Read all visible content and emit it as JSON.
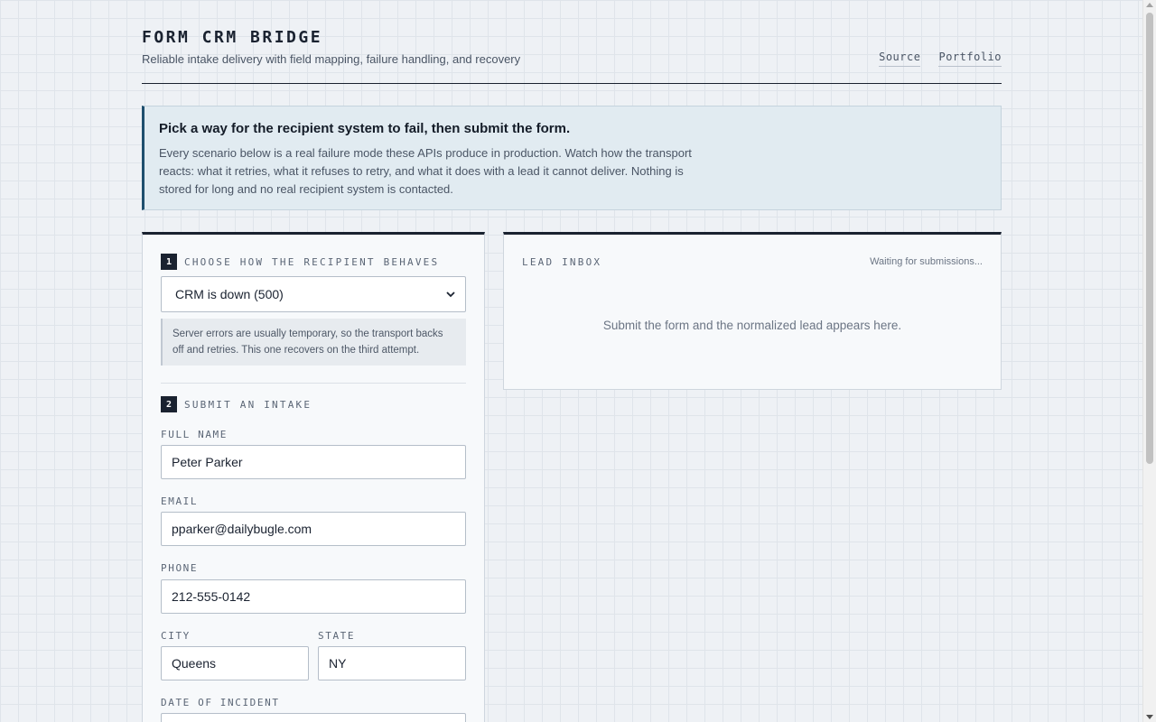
{
  "header": {
    "title": "FORM CRM BRIDGE",
    "subtitle": "Reliable intake delivery with field mapping, failure handling, and recovery",
    "links": [
      "Source",
      "Portfolio"
    ]
  },
  "banner": {
    "title": "Pick a way for the recipient system to fail, then submit the form.",
    "text": "Every scenario below is a real failure mode these APIs produce in production. Watch how the transport reacts: what it retries, what it refuses to retry, and what it does with a lead it cannot deliver. Nothing is stored for long and no real recipient system is contacted."
  },
  "step1": {
    "number": "1",
    "label": "CHOOSE HOW THE RECIPIENT BEHAVES",
    "selected": "CRM is down (500)",
    "hint": "Server errors are usually temporary, so the transport backs off and retries. This one recovers on the third attempt."
  },
  "step2": {
    "number": "2",
    "label": "SUBMIT AN INTAKE",
    "fields": {
      "full_name": {
        "label": "FULL NAME",
        "value": "Peter Parker"
      },
      "email": {
        "label": "EMAIL",
        "value": "pparker@dailybugle.com"
      },
      "phone": {
        "label": "PHONE",
        "value": "212-555-0142"
      },
      "city": {
        "label": "CITY",
        "value": "Queens"
      },
      "state": {
        "label": "STATE",
        "value": "NY"
      },
      "date_of_incident": {
        "label": "DATE OF INCIDENT",
        "value": ""
      }
    }
  },
  "inbox": {
    "title": "LEAD INBOX",
    "status": "Waiting for submissions...",
    "empty": "Submit the form and the normalized lead appears here."
  },
  "colors": {
    "ink": "#1a2230",
    "accent": "#1f4f6e",
    "banner_bg": "#e1ebf1",
    "page_bg": "#eef1f5"
  }
}
